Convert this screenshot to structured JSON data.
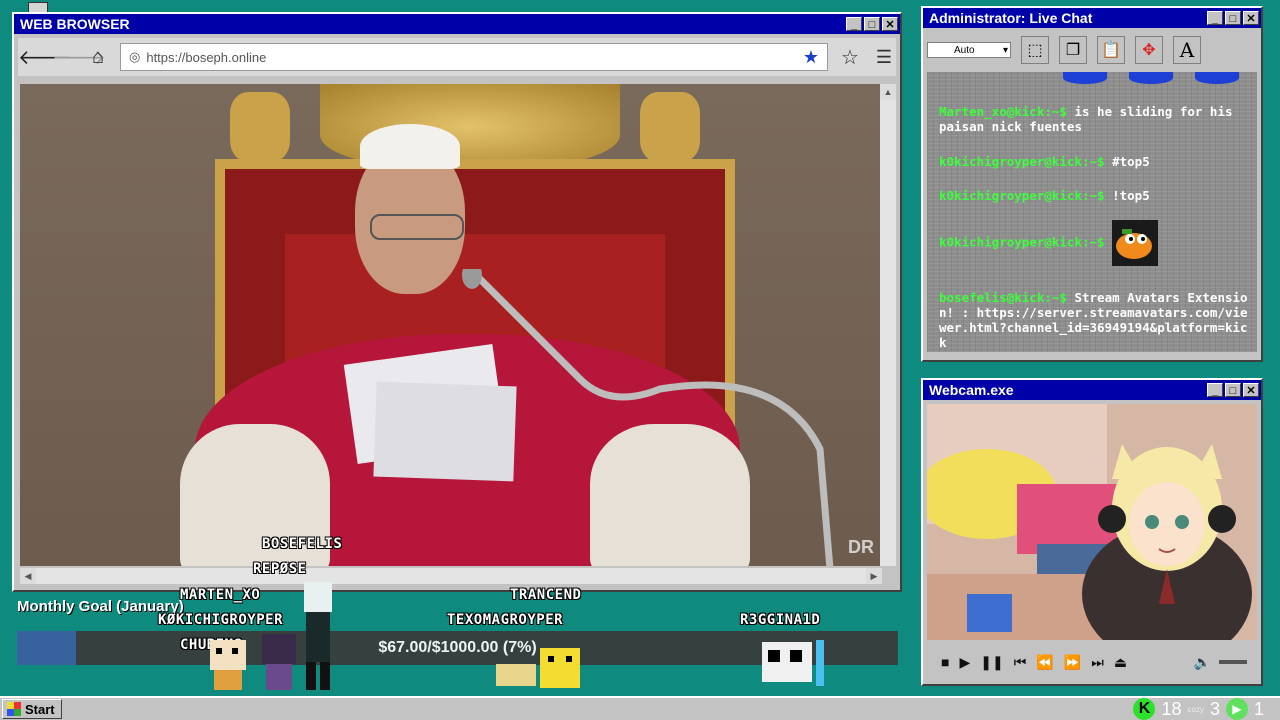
{
  "browser": {
    "title": "WEB BROWSER",
    "url": "https://boseph.online",
    "watermark": "DR"
  },
  "chat": {
    "title": "Administrator: Live Chat",
    "auto_label": "Auto",
    "messages": [
      {
        "user": "Marten_xo@kick:~$",
        "text": "is he sliding for his paisan nick fuentes"
      },
      {
        "user": "k0kichigroyper@kick:~$",
        "text": "#top5"
      },
      {
        "user": "k0kichigroyper@kick:~$",
        "text": "!top5"
      },
      {
        "user": "k0kichigroyper@kick:~$",
        "text": ""
      },
      {
        "user": "bosefelis@kick:~$",
        "text": "Stream Avatars Extension! : https://server.streamavatars.com/viewer.html?channel_id=36949194&platform=kick"
      }
    ]
  },
  "webcam": {
    "title": "Webcam.exe"
  },
  "goal": {
    "title": "Monthly Goal (January)",
    "amount_text": "$67.00/$1000.00 (7%)",
    "current": 67,
    "target": 1000,
    "fraction": 0.067
  },
  "avatars": {
    "bosefelis": "BOSEFELIS",
    "repose": "REPØSE",
    "marten": "MARTEN_XO",
    "kokichi": "KØKICHIGROYPER",
    "chubims": "CHUBIMS",
    "trancend": "TRANCEND",
    "texoma": "TEXOMAGROYPER",
    "reggina": "R3GGINA1D"
  },
  "taskbar": {
    "start_label": "Start",
    "kick_count": "18",
    "cozy_label": "cozy",
    "cozy_count": "3",
    "play_count": "1"
  },
  "colors": {
    "desktop": "#0e8a7e",
    "titlebar": "#0000a8",
    "chat_username": "#3cff3c",
    "goal_fill": "#3b5fa0"
  }
}
